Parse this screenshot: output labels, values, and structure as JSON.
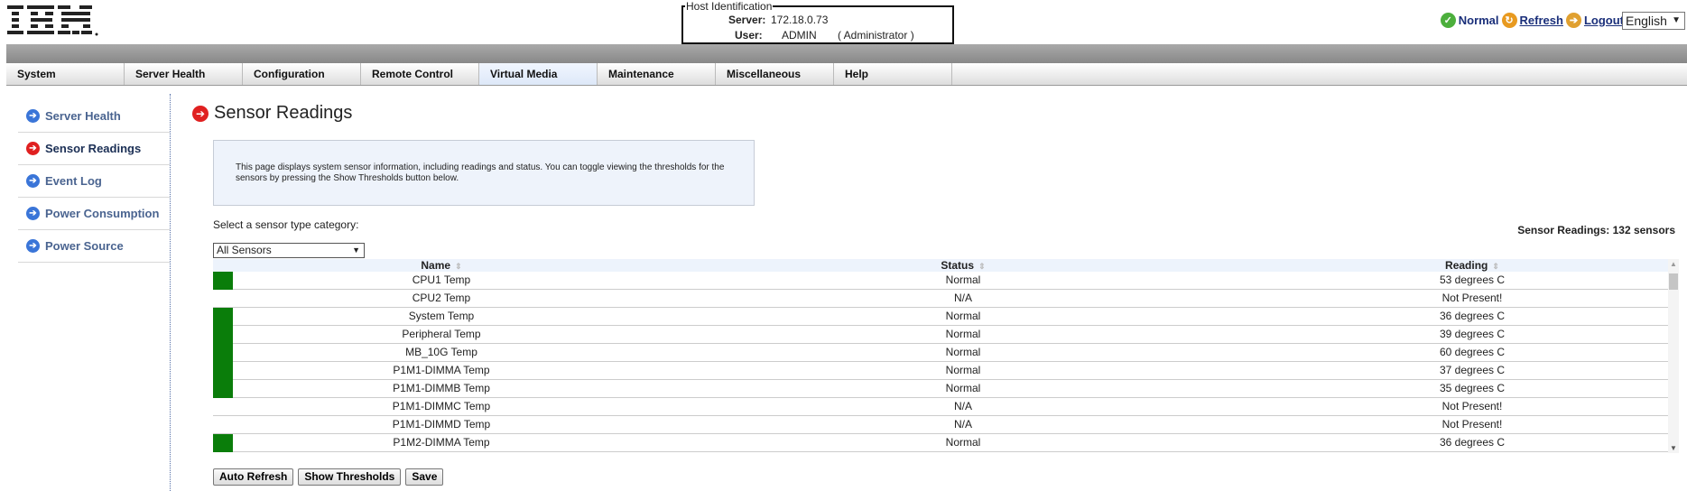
{
  "header": {
    "logo": "IBM",
    "host_legend": "Host Identification",
    "server_label": "Server:",
    "server_value": "172.18.0.73",
    "user_label": "User:",
    "user_value": "ADMIN",
    "user_role": "( Administrator )",
    "status": "Normal",
    "refresh": "Refresh",
    "logout": "Logout",
    "language": "English"
  },
  "nav": [
    "System",
    "Server Health",
    "Configuration",
    "Remote Control",
    "Virtual Media",
    "Maintenance",
    "Miscellaneous",
    "Help"
  ],
  "sidebar": [
    "Server Health",
    "Sensor Readings",
    "Event Log",
    "Power Consumption",
    "Power Source"
  ],
  "main": {
    "title": "Sensor Readings",
    "info": "This page displays system sensor information, including readings and status. You can toggle viewing the thresholds for the sensors by pressing the Show Thresholds button below.",
    "select_label": "Select a sensor type category:",
    "select_value": "All Sensors",
    "count": "Sensor Readings: 132 sensors",
    "columns": [
      "Name",
      "Status",
      "Reading"
    ],
    "rows": [
      {
        "name": "CPU1 Temp",
        "status": "Normal",
        "reading": "53 degrees C",
        "ok": true
      },
      {
        "name": "CPU2 Temp",
        "status": "N/A",
        "reading": "Not Present!",
        "ok": false
      },
      {
        "name": "System Temp",
        "status": "Normal",
        "reading": "36 degrees C",
        "ok": true
      },
      {
        "name": "Peripheral Temp",
        "status": "Normal",
        "reading": "39 degrees C",
        "ok": true
      },
      {
        "name": "MB_10G Temp",
        "status": "Normal",
        "reading": "60 degrees C",
        "ok": true
      },
      {
        "name": "P1M1-DIMMA Temp",
        "status": "Normal",
        "reading": "37 degrees C",
        "ok": true
      },
      {
        "name": "P1M1-DIMMB Temp",
        "status": "Normal",
        "reading": "35 degrees C",
        "ok": true
      },
      {
        "name": "P1M1-DIMMC Temp",
        "status": "N/A",
        "reading": "Not Present!",
        "ok": false
      },
      {
        "name": "P1M1-DIMMD Temp",
        "status": "N/A",
        "reading": "Not Present!",
        "ok": false
      },
      {
        "name": "P1M2-DIMMA Temp",
        "status": "Normal",
        "reading": "36 degrees C",
        "ok": true
      }
    ],
    "buttons": [
      "Auto Refresh",
      "Show Thresholds",
      "Save"
    ]
  },
  "colors": {
    "ok": "#0a7d0a",
    "accent": "#e02020"
  }
}
